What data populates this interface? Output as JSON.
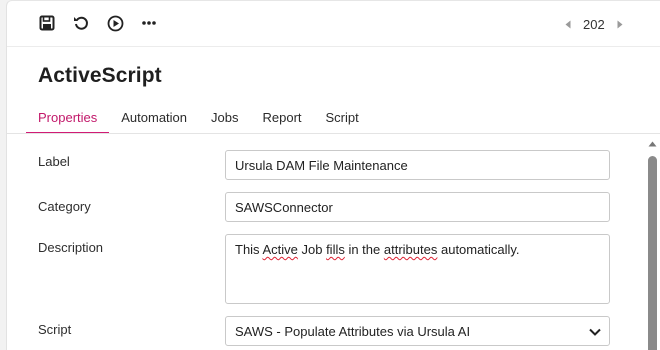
{
  "toolbar": {
    "icons": [
      "save-icon",
      "refresh-icon",
      "play-icon",
      "more-icon"
    ],
    "pager": {
      "value": "202",
      "prev_icon": "chevron-left-icon",
      "next_icon": "chevron-right-icon"
    }
  },
  "page": {
    "title": "ActiveScript"
  },
  "tabs": [
    {
      "label": "Properties",
      "active": true
    },
    {
      "label": "Automation",
      "active": false
    },
    {
      "label": "Jobs",
      "active": false
    },
    {
      "label": "Report",
      "active": false
    },
    {
      "label": "Script",
      "active": false
    }
  ],
  "form": {
    "label": {
      "caption": "Label",
      "value": "Ursula DAM File Maintenance"
    },
    "category": {
      "caption": "Category",
      "value": "SAWSConnector"
    },
    "description": {
      "caption": "Description",
      "text_before": "This ",
      "word_active": "Active",
      "text_mid": " Job ",
      "word_fills": "fills",
      "text_mid2": " in the ",
      "word_attributes": "attributes",
      "text_mid3": " ",
      "word_auto": "automatically.",
      "text_after": ""
    },
    "script": {
      "caption": "Script",
      "value": "SAWS - Populate Attributes via Ursula AI"
    }
  },
  "colors": {
    "accent": "#d11b75",
    "accent_text": "#c2186a",
    "scroll_thumb": "#8a8a8a"
  }
}
